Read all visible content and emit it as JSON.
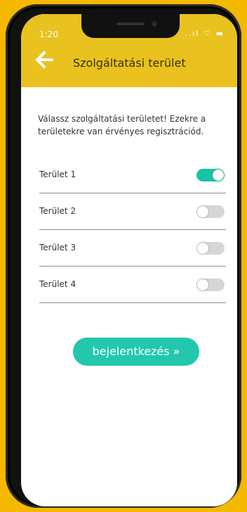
{
  "status": {
    "time": "1:20",
    "icons": "..ıl ⌔ ▬"
  },
  "header": {
    "title": "Szolgáltatási terület",
    "back_icon": "arrow-left-icon"
  },
  "intro_text": "Válassz szolgáltatási területet! Ezekre a területekre van érvényes regisztrációd.",
  "areas": [
    {
      "label": "Terület 1",
      "enabled": true
    },
    {
      "label": "Terület 2",
      "enabled": false
    },
    {
      "label": "Terület 3",
      "enabled": false
    },
    {
      "label": "Terület 4",
      "enabled": false
    }
  ],
  "login_button": "bejelentkezés »",
  "colors": {
    "header": "#e9c21f",
    "accent": "#22c7ae",
    "background": "#f5b800"
  }
}
